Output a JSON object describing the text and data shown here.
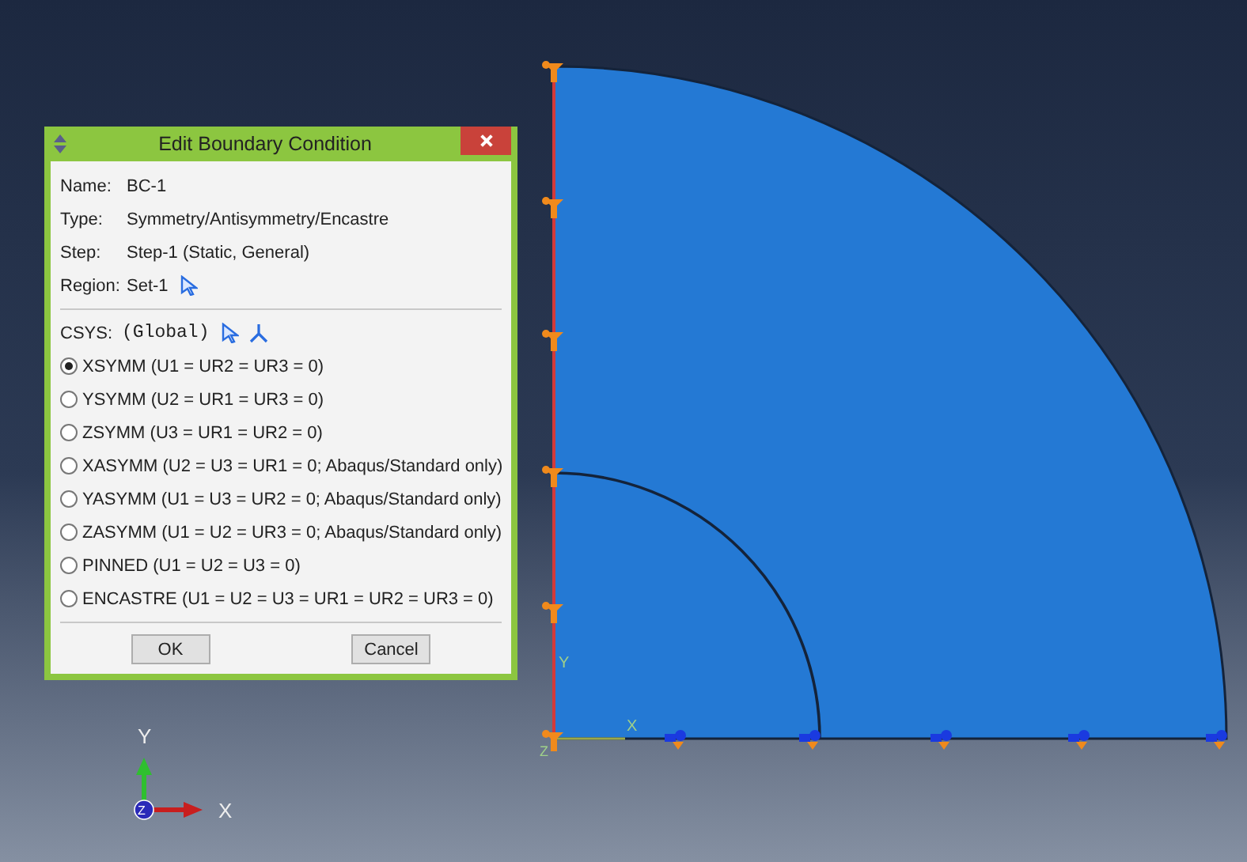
{
  "dialog": {
    "title": "Edit Boundary Condition",
    "fields": [
      {
        "label": "Name:",
        "value": "BC-1",
        "pick_icon": false
      },
      {
        "label": "Type:",
        "value": "Symmetry/Antisymmetry/Encastre",
        "pick_icon": false
      },
      {
        "label": "Step:",
        "value": "Step-1 (Static, General)",
        "pick_icon": false
      },
      {
        "label": "Region:",
        "value": "Set-1",
        "pick_icon": true
      }
    ],
    "csys": {
      "label": "CSYS:",
      "value": "(Global)"
    },
    "options": [
      {
        "label": "XSYMM (U1 = UR2 = UR3 = 0)",
        "selected": true
      },
      {
        "label": "YSYMM (U2 = UR1 = UR3 = 0)",
        "selected": false
      },
      {
        "label": "ZSYMM (U3 = UR1 = UR2 = 0)",
        "selected": false
      },
      {
        "label": "XASYMM (U2 = U3 = UR1 = 0; Abaqus/Standard only)",
        "selected": false
      },
      {
        "label": "YASYMM (U1 = U3 = UR2 = 0; Abaqus/Standard only)",
        "selected": false
      },
      {
        "label": "ZASYMM (U1 = U2 = UR3 = 0; Abaqus/Standard only)",
        "selected": false
      },
      {
        "label": "PINNED (U1 = U2 = U3 = 0)",
        "selected": false
      },
      {
        "label": "ENCASTRE (U1 = U2 = U3 = UR1 = UR2 = UR3 = 0)",
        "selected": false
      }
    ],
    "buttons": [
      "OK",
      "Cancel"
    ]
  },
  "model_axes": {
    "y": "Y",
    "x": "X",
    "z": "Z"
  },
  "triad": {
    "y": "Y",
    "x": "X",
    "z": "Z"
  }
}
